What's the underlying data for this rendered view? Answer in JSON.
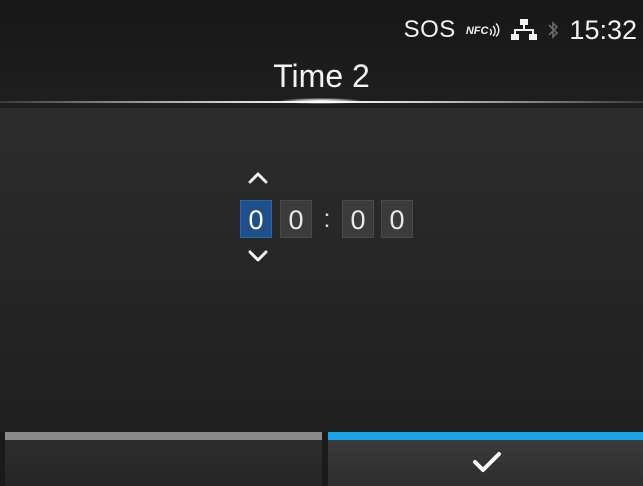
{
  "status": {
    "sos": "SOS",
    "nfc": "NFC",
    "clock": "15:32"
  },
  "title": "Time 2",
  "time_editor": {
    "digits": [
      "0",
      "0",
      "0",
      "0"
    ],
    "separator": ":",
    "selected_index": 0
  },
  "softkeys": {
    "left_color": "#8a8a8a",
    "right_color": "#1aa3e6",
    "right_icon": "check-icon"
  },
  "colors": {
    "selected_digit_bg": "#1f4f8c",
    "accent": "#1aa3e6"
  }
}
